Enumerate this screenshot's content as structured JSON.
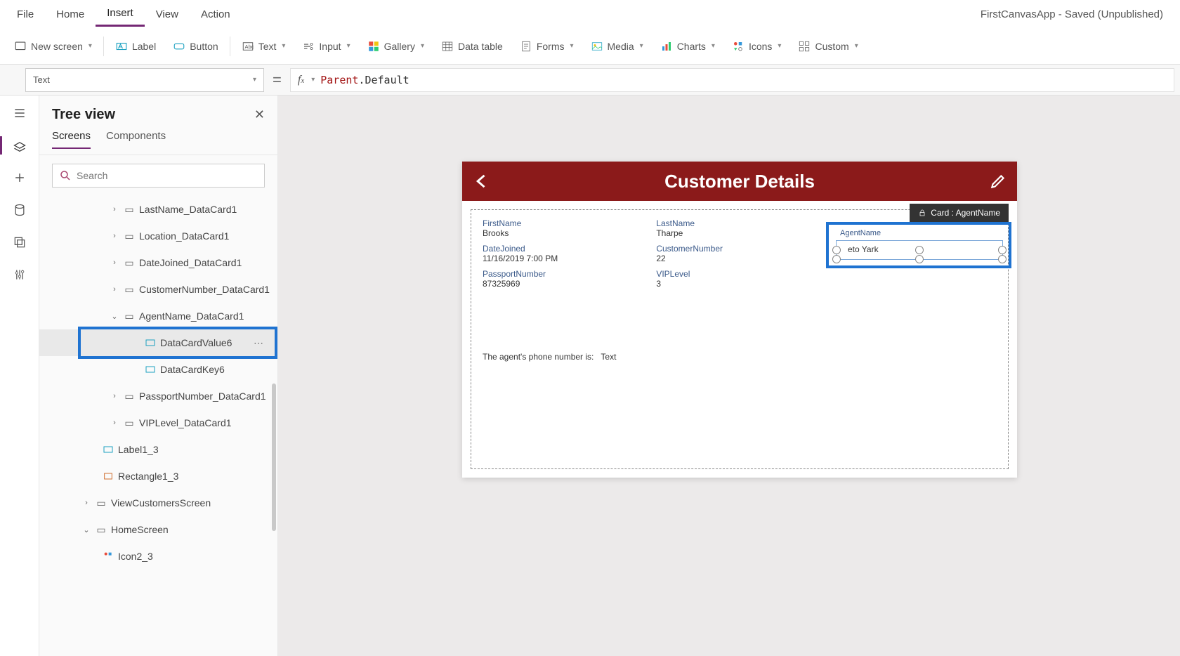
{
  "app_status": "FirstCanvasApp - Saved (Unpublished)",
  "menu": {
    "file": "File",
    "home": "Home",
    "insert": "Insert",
    "view": "View",
    "action": "Action"
  },
  "ribbon": {
    "new_screen": "New screen",
    "label": "Label",
    "button": "Button",
    "text": "Text",
    "input": "Input",
    "gallery": "Gallery",
    "data_table": "Data table",
    "forms": "Forms",
    "media": "Media",
    "charts": "Charts",
    "icons": "Icons",
    "custom": "Custom"
  },
  "property_selector": "Text",
  "formula": {
    "parent": "Parent",
    "prop": "Default"
  },
  "tree": {
    "title": "Tree view",
    "tab_screens": "Screens",
    "tab_components": "Components",
    "search_placeholder": "Search",
    "nodes": {
      "lastname": "LastName_DataCard1",
      "location": "Location_DataCard1",
      "datejoined": "DateJoined_DataCard1",
      "custnum": "CustomerNumber_DataCard1",
      "agent": "AgentName_DataCard1",
      "dcval6": "DataCardValue6",
      "dckey6": "DataCardKey6",
      "passport": "PassportNumber_DataCard1",
      "viplevel": "VIPLevel_DataCard1",
      "label13": "Label1_3",
      "rect13": "Rectangle1_3",
      "viewcust": "ViewCustomersScreen",
      "homescreen": "HomeScreen",
      "icon23": "Icon2_3"
    }
  },
  "canvas": {
    "title": "Customer Details",
    "card_badge": "Card : AgentName",
    "fields": {
      "firstname_l": "FirstName",
      "firstname_v": "Brooks",
      "lastname_l": "LastName",
      "lastname_v": "Tharpe",
      "datejoined_l": "DateJoined",
      "datejoined_v": "11/16/2019 7:00 PM",
      "custnum_l": "CustomerNumber",
      "custnum_v": "22",
      "passport_l": "PassportNumber",
      "passport_v": "87325969",
      "vip_l": "VIPLevel",
      "vip_v": "3",
      "agent_l": "AgentName",
      "agent_v": "eto Yark"
    },
    "footer_a": "The agent's phone number is:",
    "footer_b": "Text"
  }
}
